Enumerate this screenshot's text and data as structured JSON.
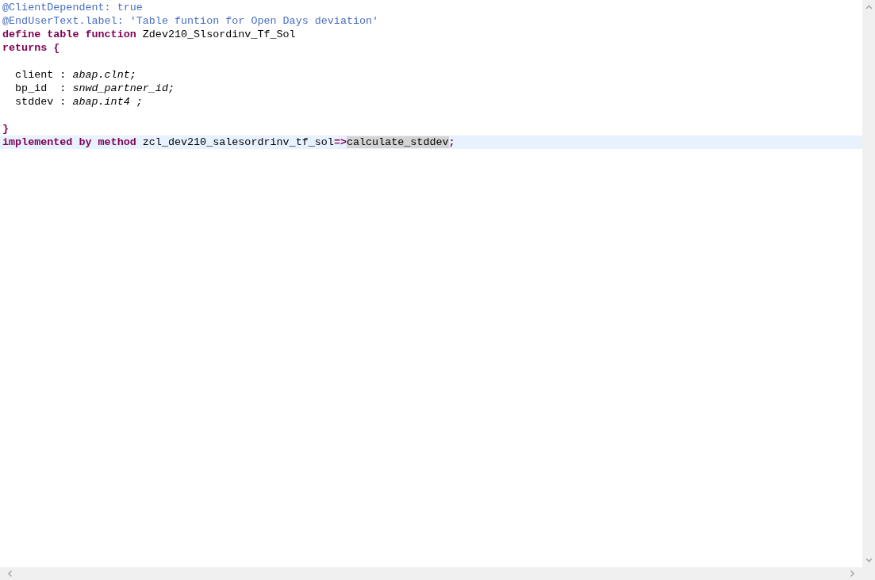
{
  "editor": {
    "lines": [
      {
        "current": false,
        "tokens": [
          {
            "kind": "annotation",
            "text": "@ClientDependent: true"
          }
        ]
      },
      {
        "current": false,
        "tokens": [
          {
            "kind": "annotation",
            "text": "@EndUserText.label: 'Table funtion for Open Days deviation'"
          }
        ]
      },
      {
        "current": false,
        "tokens": [
          {
            "kind": "keyword",
            "text": "define table function "
          },
          {
            "kind": "plain",
            "text": "Zdev210_Slsordinv_Tf_Sol"
          }
        ]
      },
      {
        "current": false,
        "tokens": [
          {
            "kind": "keyword",
            "text": "returns {"
          }
        ]
      },
      {
        "current": false
      },
      {
        "current": false,
        "tokens": [
          {
            "kind": "plain",
            "text": "  client : "
          },
          {
            "kind": "type",
            "text": "abap.clnt;"
          }
        ]
      },
      {
        "current": false,
        "tokens": [
          {
            "kind": "plain",
            "text": "  bp_id  : "
          },
          {
            "kind": "type",
            "text": "snwd_partner_id;"
          }
        ]
      },
      {
        "current": false,
        "tokens": [
          {
            "kind": "plain",
            "text": "  stddev : "
          },
          {
            "kind": "type",
            "text": "abap.int4 ;"
          }
        ]
      },
      {
        "current": false
      },
      {
        "current": false,
        "tokens": [
          {
            "kind": "keyword",
            "text": "}"
          }
        ]
      },
      {
        "current": true,
        "tokens": [
          {
            "kind": "keyword",
            "text": "implemented by method "
          },
          {
            "kind": "plain",
            "text": "zcl_dev210_salesordrinv_tf_sol"
          },
          {
            "kind": "keyword",
            "text": "=>"
          },
          {
            "kind": "plain",
            "text": "calculate_stddev",
            "marked": true
          },
          {
            "kind": "keyword",
            "text": ";"
          }
        ]
      }
    ]
  }
}
